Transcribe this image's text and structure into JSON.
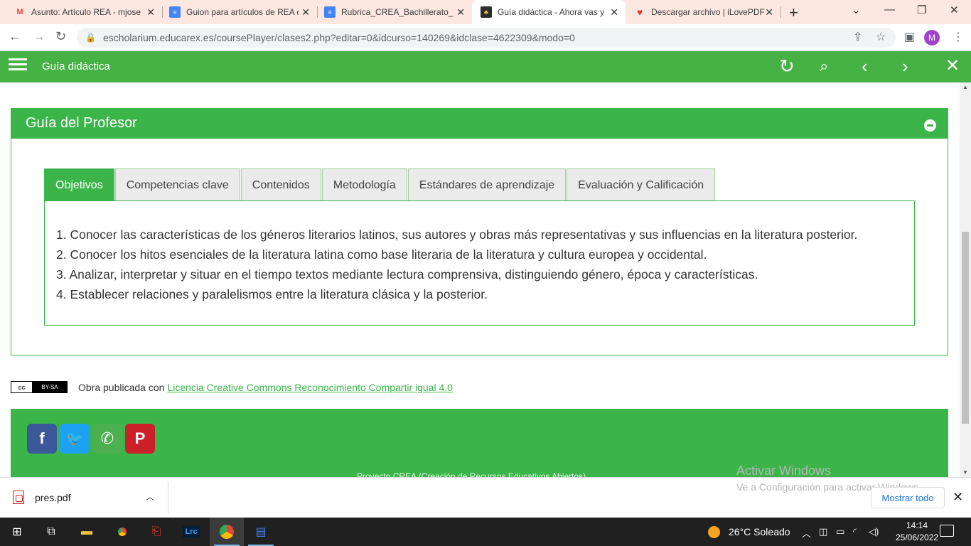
{
  "browser": {
    "tabs": [
      {
        "title": "Asunto: Artículo REA - mjose",
        "icon": "gmail-icon"
      },
      {
        "title": "Guion para artículos de REA d",
        "icon": "docs-icon"
      },
      {
        "title": "Rubrica_CREA_Bachillerato_La",
        "icon": "docs-icon"
      },
      {
        "title": "Guía didáctica - Ahora vas y",
        "icon": "app-icon",
        "active": true
      },
      {
        "title": "Descargar archivo | iLovePDF",
        "icon": "heart-icon"
      }
    ],
    "url": "escholarium.educarex.es/coursePlayer/clases2.php?editar=0&idcurso=140269&idclase=4622309&modo=0",
    "profile_initial": "M"
  },
  "app": {
    "title": "Guía didáctica"
  },
  "panel": {
    "title": "Guía del Profesor",
    "tabs": [
      "Objetivos",
      "Competencias clave",
      "Contenidos",
      "Metodología",
      "Estándares de aprendizaje",
      "Evaluación y Calificación"
    ],
    "active_tab": "Objetivos",
    "objectives": [
      "1. Conocer las características de los géneros literarios latinos, sus autores y obras más representativas y sus influencias en la literatura posterior.",
      "2. Conocer los hitos esenciales de la literatura latina como base literaria de la literatura y cultura europea y occidental.",
      "3. Analizar, interpretar y situar en el tiempo textos mediante lectura comprensiva, distinguiendo género, época y características.",
      "4. Establecer relaciones y paralelismos entre la literatura clásica y la posterior."
    ]
  },
  "license": {
    "prefix": "Obra publicada con",
    "link": "Licencia Creative Commons Reconocimiento Compartir igual 4.0",
    "badge_cc": "cc",
    "badge_by": "BY-SA"
  },
  "footer": {
    "social": [
      {
        "name": "facebook",
        "glyph": "f",
        "color": "#3b5998"
      },
      {
        "name": "twitter",
        "glyph": "t",
        "color": "#1da1f2"
      },
      {
        "name": "whatsapp",
        "glyph": "✆",
        "color": "#4caf50"
      },
      {
        "name": "pinterest",
        "glyph": "P",
        "color": "#cb2027"
      }
    ],
    "credit": "Proyecto CREA (Creación de Recursos Educativos Abiertos)"
  },
  "watermark": {
    "line1": "Activar Windows",
    "line2": "Ve a Configuración para activar Windows."
  },
  "downloads": {
    "file": "pres.pdf",
    "show_all": "Mostrar todo"
  },
  "taskbar": {
    "weather": "26°C  Soleado",
    "time": "14:14",
    "date": "25/06/2022"
  }
}
